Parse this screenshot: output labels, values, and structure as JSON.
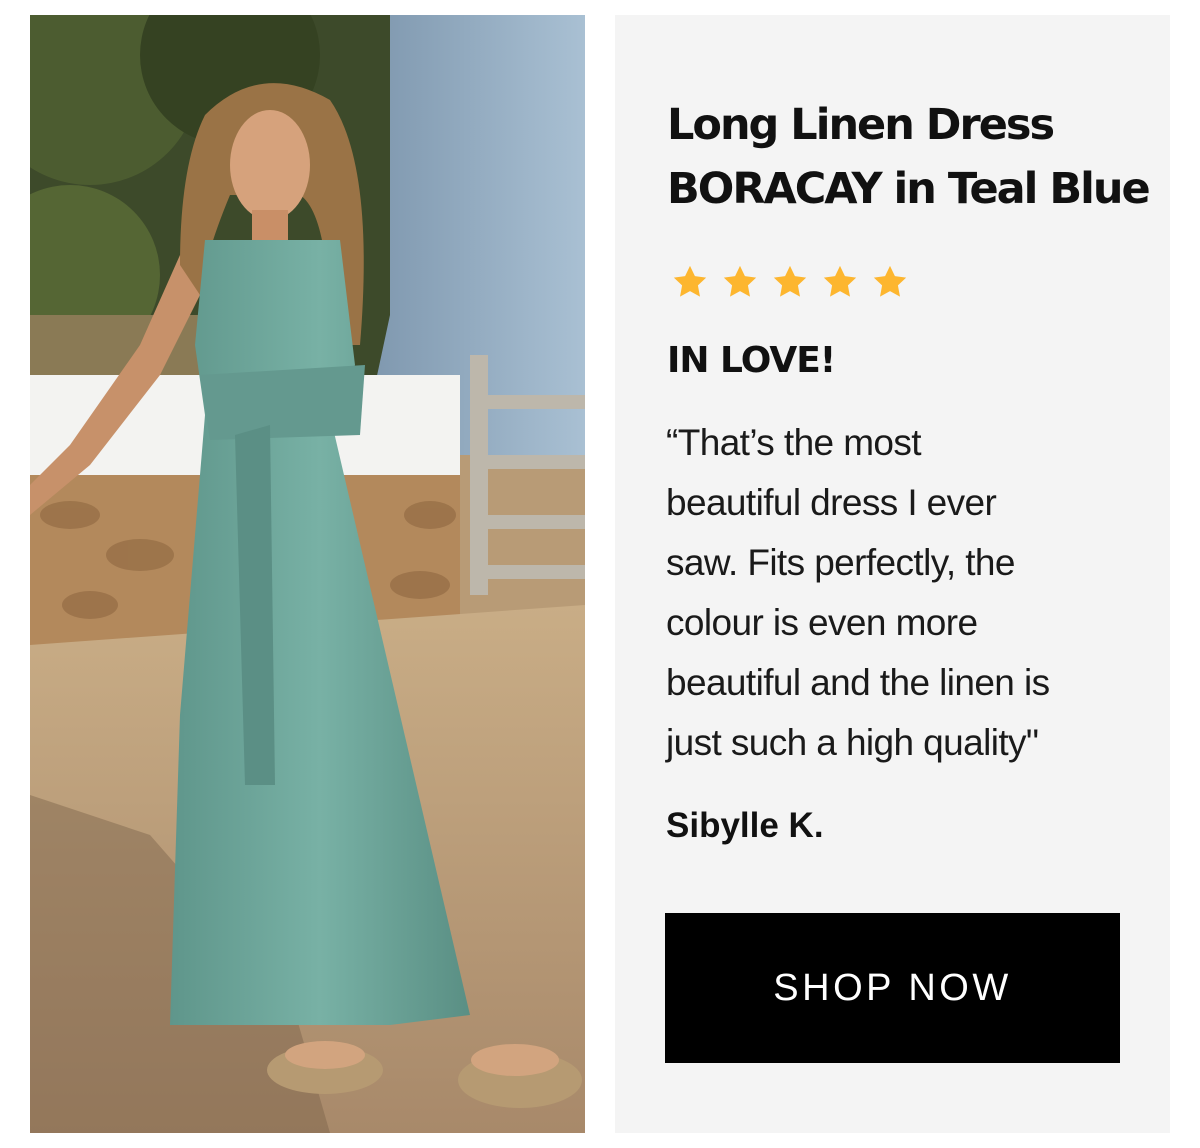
{
  "product": {
    "title_lines": [
      "Long Linen Dress",
      "BORACAY in Teal Blue"
    ],
    "rating": 5,
    "rating_max": 5,
    "star_color": "#FDB62F"
  },
  "review": {
    "headline": "IN LOVE!",
    "quote_lines": [
      "“That’s the most",
      "beautiful dress I ever",
      "saw. Fits perfectly, the",
      "colour is even more",
      "beautiful and the linen is",
      "just such a high quality\""
    ],
    "author": "Sibylle K."
  },
  "cta": {
    "label": "SHOP NOW"
  },
  "colors": {
    "panel_background": "#F4F4F4",
    "button_background": "#000000",
    "dress_teal": "#6FA79C"
  }
}
